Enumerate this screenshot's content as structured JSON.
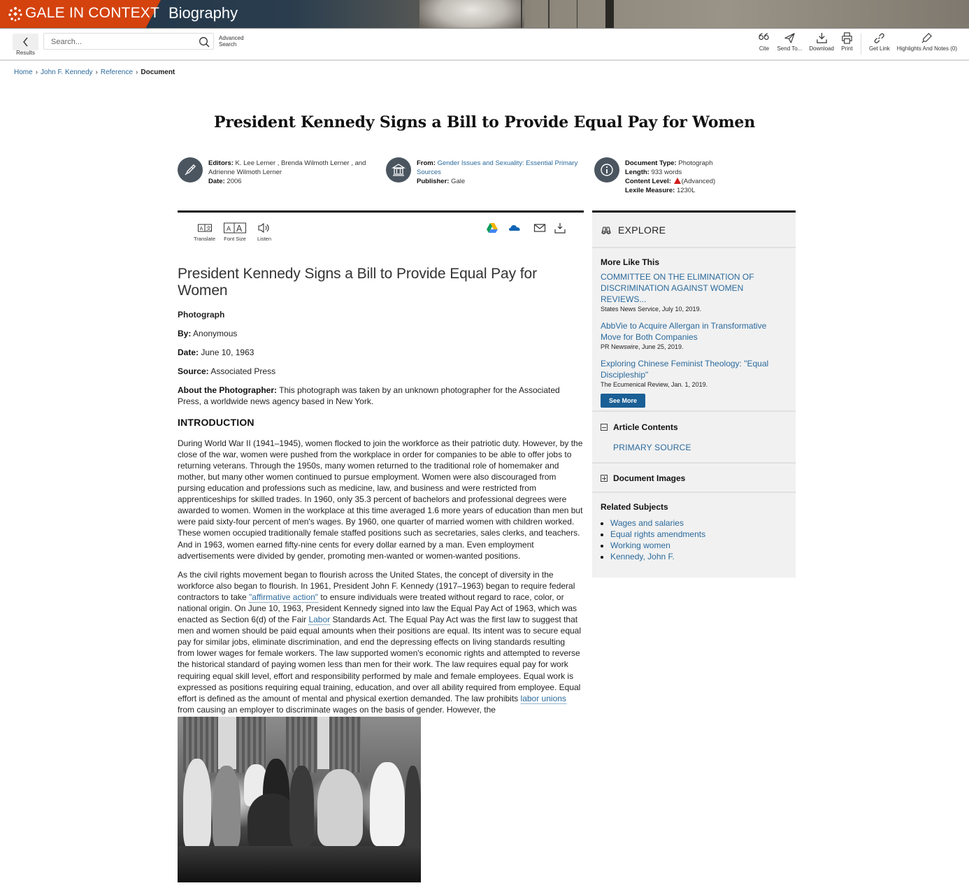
{
  "banner": {
    "brand": "GALE IN CONTEXT",
    "section": "Biography",
    "brand_color": "#d4420e"
  },
  "toolbar": {
    "back_label": "Results",
    "search_placeholder": "Search...",
    "advanced_search": "Advanced Search",
    "tools": [
      {
        "icon": "quote-icon",
        "label": "Cite"
      },
      {
        "icon": "send-icon",
        "label": "Send To..."
      },
      {
        "icon": "download-icon",
        "label": "Download"
      },
      {
        "icon": "print-icon",
        "label": "Print"
      },
      {
        "icon": "link-icon",
        "label": "Get Link"
      },
      {
        "icon": "highlighter-icon",
        "label": "Highlights And Notes (0)"
      }
    ]
  },
  "breadcrumb": [
    {
      "label": "Home"
    },
    {
      "label": "John F. Kennedy"
    },
    {
      "label": "Reference"
    },
    {
      "label": "Document",
      "current": true
    }
  ],
  "document": {
    "title": "President Kennedy Signs a Bill to Provide Equal Pay for Women",
    "meta": {
      "editors_label": "Editors:",
      "editors": "K. Lee Lerner , Brenda Wilmoth Lerner , and Adrienne Wilmoth Lerner",
      "date_label": "Date:",
      "date": "2006",
      "from_label": "From:",
      "from": "Gender Issues and Sexuality: Essential Primary Sources",
      "publisher_label": "Publisher:",
      "publisher": "Gale",
      "doc_type_label": "Document Type:",
      "doc_type": "Photograph",
      "length_label": "Length:",
      "length": "933 words",
      "content_level_label": "Content Level:",
      "content_level": "(Advanced)",
      "content_level_color": "#d01c1c",
      "lexile_label": "Lexile Measure:",
      "lexile": "1230L"
    },
    "doc_tools": [
      {
        "icon": "translate-icon",
        "label": "Translate"
      },
      {
        "icon": "font-size-icon",
        "label": "Font Size"
      },
      {
        "icon": "listen-icon",
        "label": "Listen"
      }
    ],
    "share_icons": [
      "google-drive-icon",
      "onedrive-icon",
      "email-icon",
      "download-icon"
    ]
  },
  "article": {
    "title": "President Kennedy Signs a Bill to Provide Equal Pay for Women",
    "type": "Photograph",
    "by_label": "By:",
    "by": "Anonymous",
    "date_label": "Date:",
    "date": "June 10, 1963",
    "source_label": "Source:",
    "source": "Associated Press",
    "about_label": "About the Photographer:",
    "about": "This photograph was taken by an unknown photographer for the Associated Press, a worldwide news agency based in New York.",
    "intro_heading": "INTRODUCTION",
    "para1": "During World War II (1941–1945), women flocked to join the workforce as their patriotic duty. However, by the close of the war, women were pushed from the workplace in order for companies to be able to offer jobs to returning veterans. Through the 1950s, many women returned to the traditional role of homemaker and mother, but many other women continued to pursue employment. Women were also discouraged from pursing education and professions such as medicine, law, and business and were restricted from apprenticeships for skilled trades. In 1960, only 35.3 percent of bachelors and professional degrees were awarded to women. Women in the workplace at this time averaged 1.6 more years of education than men but were paid sixty-four percent of men's wages. By 1960, one quarter of married women with children worked. These women occupied traditionally female staffed positions such as secretaries, sales clerks, and teachers. And in 1963, women earned fifty-nine cents for every dollar earned by a man. Even employment advertisements were divided by gender, promoting men-wanted or women-wanted positions.",
    "para2_a": "As the civil rights movement began to flourish across the United States, the concept of diversity in the workforce also began to flourish. In 1961, President John F. Kennedy (1917–1963) began to require federal contractors to take ",
    "para2_link1": "\"affirmative action\"",
    "para2_b": " to ensure individuals were treated without regard to race, color, or national origin. On June 10, 1963, President Kennedy signed into law the Equal Pay Act of 1963, which was enacted as Section 6(d) of the Fair ",
    "para2_link2": "Labor",
    "para2_c": " Standards Act. The Equal Pay Act was the first law to suggest that men and women should be paid equal amounts when their positions are equal. Its intent was to secure equal pay for similar jobs, eliminate discrimination, and end the depressing effects on living standards resulting from lower wages for female workers. The law supported women's economic rights and attempted to reverse the historical standard of paying women less than men for their work. The law requires equal pay for work requiring equal skill level, effort and responsibility performed by male and female employees. Equal work is expressed as positions requiring equal training, education, and over all ability required from employee. Equal effort is defined as the amount of mental and physical exertion demanded. The law prohibits ",
    "para2_link3": "labor unions",
    "para2_d": " from causing an employer to discriminate wages on the basis of gender. However, the",
    "photo_alt": "President Kennedy signing the Equal Pay Act surrounded by women and officials"
  },
  "sidebar": {
    "explore": "EXPLORE",
    "more_like_this": "More Like This",
    "items": [
      {
        "title": "COMMITTEE ON THE ELIMINATION OF DISCRIMINATION AGAINST WOMEN REVIEWS...",
        "source": "States News Service, July 10, 2019."
      },
      {
        "title": "AbbVie to Acquire Allergan in Transformative Move for Both Companies",
        "source": "PR Newswire, June 25, 2019."
      },
      {
        "title": "Exploring Chinese Feminist Theology: \"Equal Discipleship\"",
        "source": "The Ecumenical Review, Jan. 1, 2019."
      }
    ],
    "see_more": "See More",
    "article_contents": "Article Contents",
    "article_contents_items": [
      "PRIMARY SOURCE"
    ],
    "document_images": "Document Images",
    "related_subjects": "Related Subjects",
    "subjects": [
      "Wages and salaries",
      "Equal rights amendments",
      "Working women",
      "Kennedy, John F."
    ],
    "link_color": "#2b6a9c",
    "button_color": "#1a5f95"
  }
}
